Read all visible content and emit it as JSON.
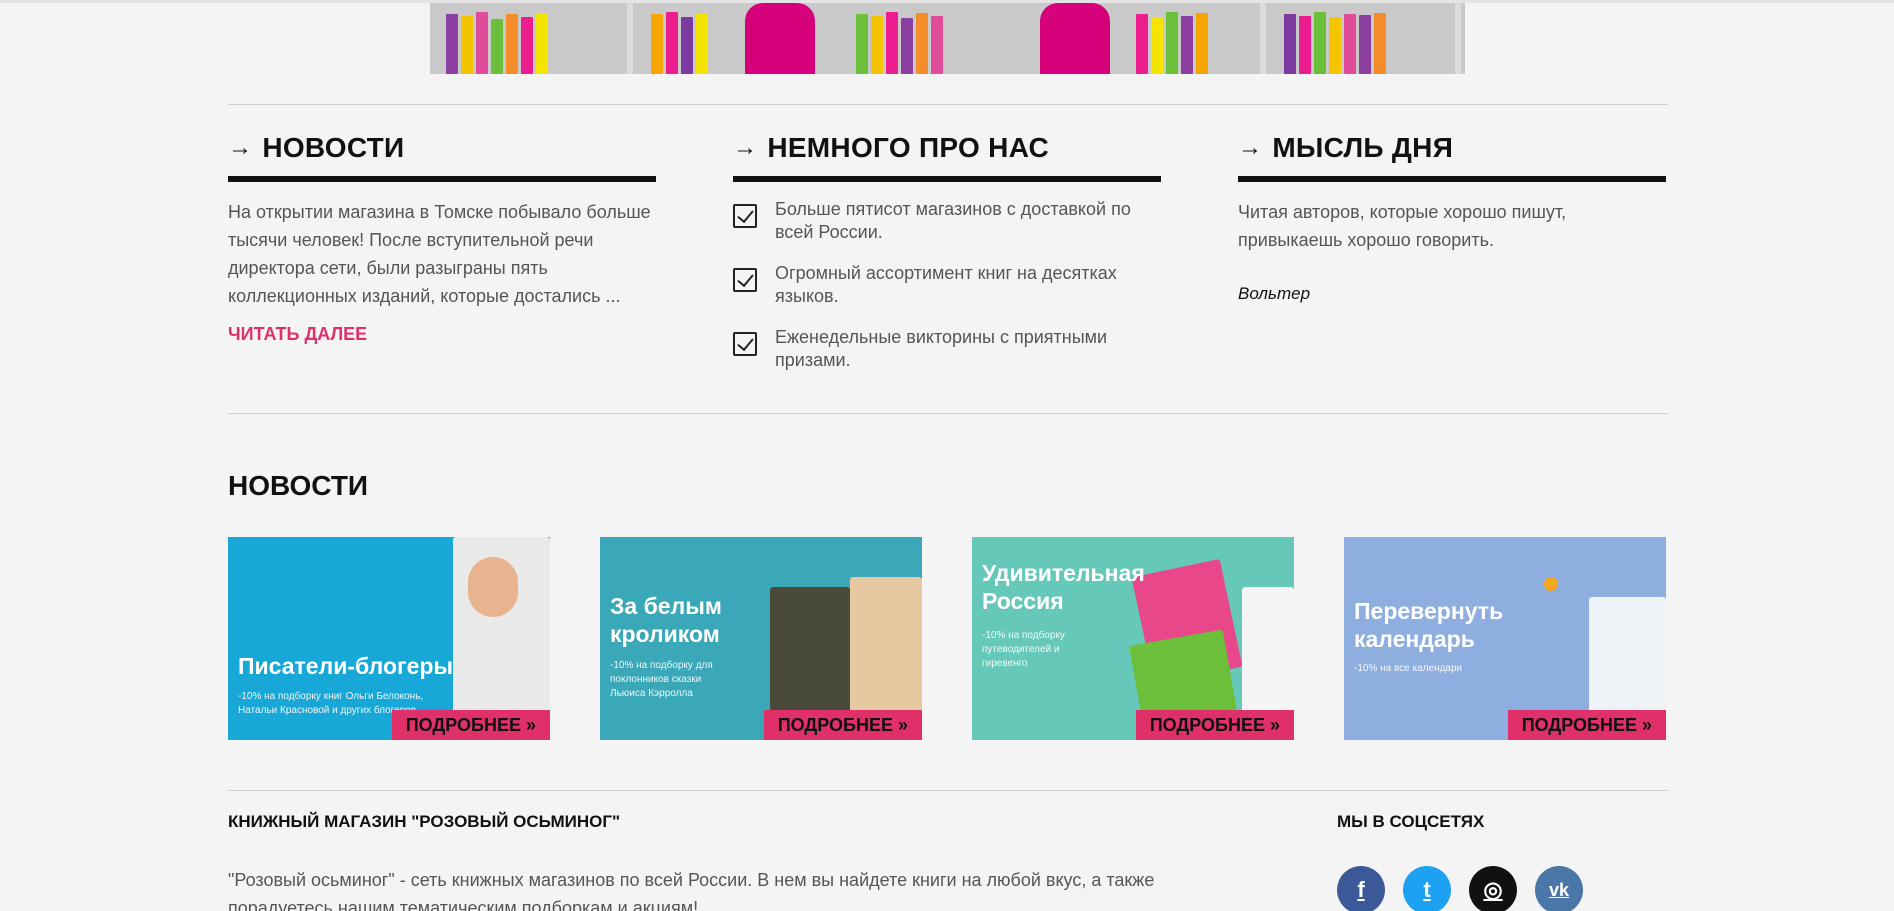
{
  "columns": {
    "news": {
      "arrow": "→",
      "title": "НОВОСТИ",
      "text": "На открытии магазина в Томске побывало больше тысячи человек! После вступительной речи директора сети, были разыграны пять коллекционных изданий, которые достались ...",
      "read_more": "ЧИТАТЬ ДАЛЕЕ"
    },
    "about": {
      "arrow": "→",
      "title": "НЕМНОГО ПРО НАС",
      "items": [
        "Больше пятисот магазинов с доставкой по всей России.",
        "Огромный ассортимент книг на десятках языков.",
        "Еженедельные викторины с приятными призами."
      ]
    },
    "quote": {
      "arrow": "→",
      "title": "МЫСЛЬ ДНЯ",
      "text": "Читая авторов, которые хорошо пишут, привыкаешь хорошо говорить.",
      "author": "Вольтер"
    }
  },
  "news_section": {
    "heading": "НОВОСТИ",
    "more_label": "ПОДРОБНЕЕ »",
    "cards": [
      {
        "title": "Писатели-блогеры",
        "subtitle": "-10% на подборку книг Ольги Белоконь, Натальи Красновой и других блогеров",
        "bg": "#18a8d8"
      },
      {
        "title": "За белым кроликом",
        "subtitle": "-10% на подборку для поклонников сказки Льюиса Кэрролла",
        "bg": "#3aa8b8"
      },
      {
        "title": "Удивительная Россия",
        "subtitle": "-10% на подборку путеводителей и гиревенго",
        "bg": "#66c8b8"
      },
      {
        "title": "Перевернуть календарь",
        "subtitle": "-10% на все календари",
        "bg": "#8eaee0"
      }
    ]
  },
  "footer": {
    "store_title": "КНИЖНЫЙ МАГАЗИН \"РОЗОВЫЙ ОСЬМИНОГ\"",
    "store_text": "\"Розовый осьминог\" - сеть книжных магазинов по всей России. В нем вы найдете книги на любой вкус, а также порадуетесь нашим тематическим подборкам и акциям!",
    "social_title": "МЫ В СОЦСЕТЯХ",
    "socials": [
      {
        "name": "facebook-icon",
        "glyph": "f",
        "color": "#3b5998"
      },
      {
        "name": "twitter-icon",
        "glyph": "t",
        "color": "#1da1f2"
      },
      {
        "name": "instagram-icon",
        "glyph": "◎",
        "color": "#111111"
      },
      {
        "name": "vk-icon",
        "glyph": "vk",
        "color": "#4a76a8"
      }
    ]
  },
  "colors": {
    "accent": "#e0306a",
    "text": "#555555",
    "heading": "#111111",
    "background": "#f4f4f4"
  }
}
